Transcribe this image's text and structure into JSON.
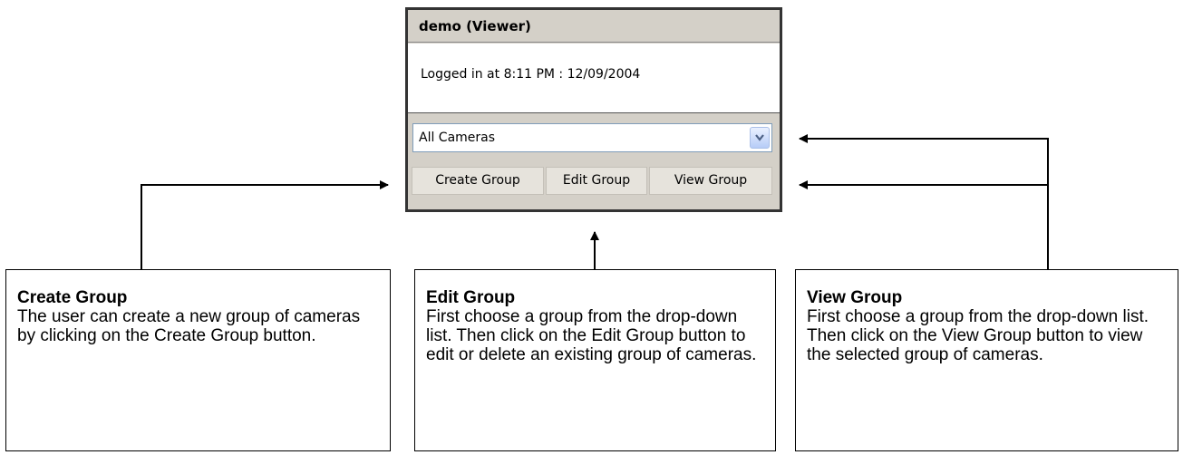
{
  "widget": {
    "title": "demo (Viewer)",
    "login_text": "Logged in at 8:11 PM : 12/09/2004",
    "group_select": {
      "value": "All Cameras",
      "arrow_icon": "chevron-down-icon"
    },
    "buttons": {
      "create": "Create Group",
      "edit": "Edit Group",
      "view": "View Group"
    }
  },
  "callouts": {
    "create": {
      "title": "Create Group",
      "body": "The user can create a new group of cameras by clicking on the Create Group button."
    },
    "edit": {
      "title": "Edit Group",
      "body": "First choose a group from the drop-down list.  Then click on the Edit Group button to edit or delete an existing group of cameras."
    },
    "view": {
      "title": "View Group",
      "body": "First choose a group from the drop-down list.  Then click on the View Group button to view the selected group of cameras."
    }
  }
}
